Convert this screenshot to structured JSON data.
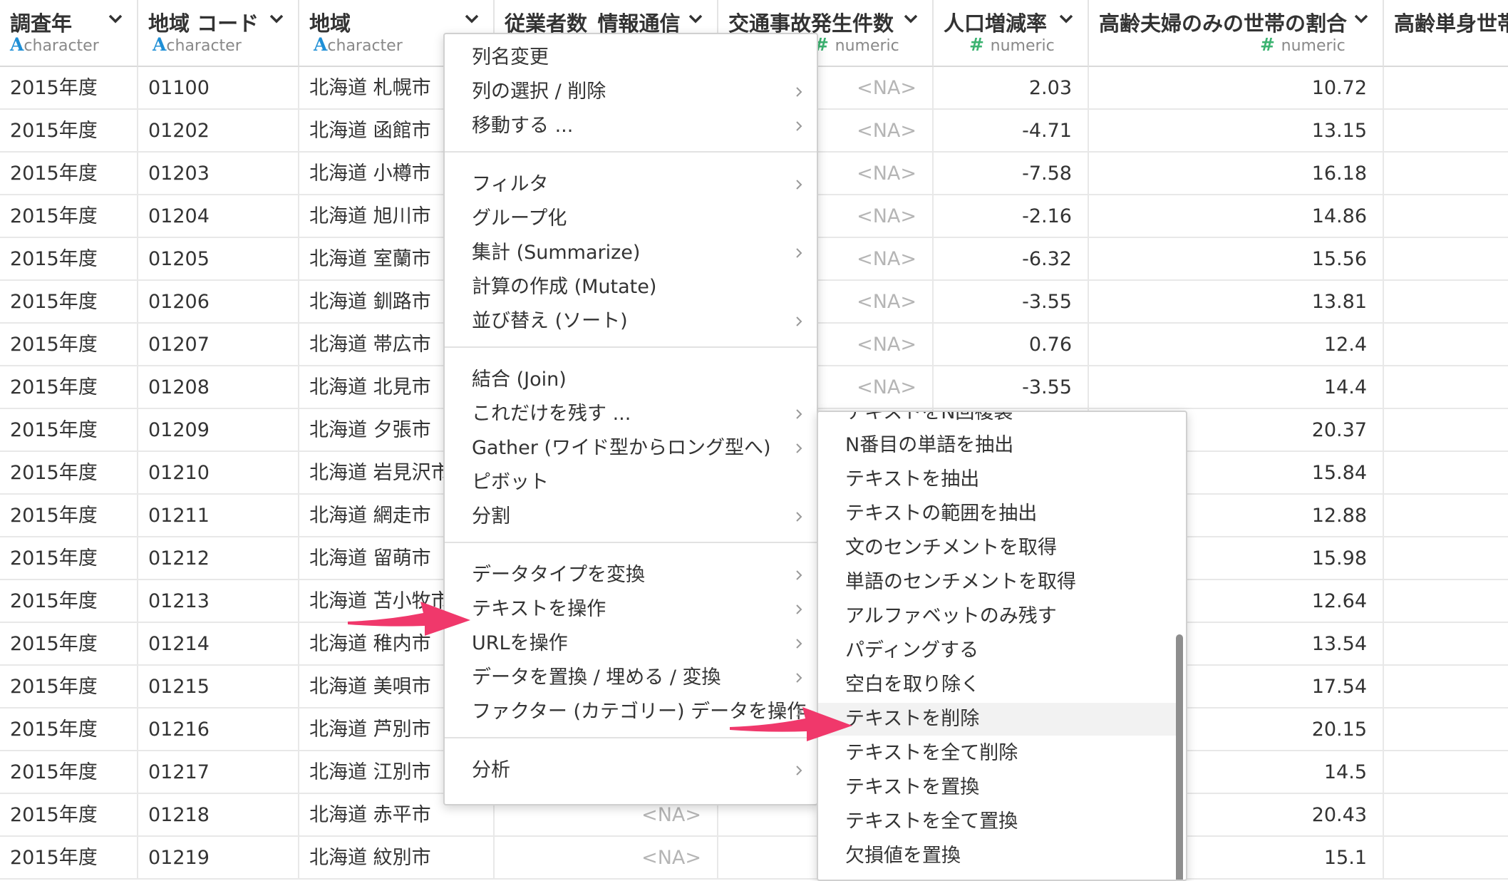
{
  "columns": [
    {
      "name": "調査年",
      "type": "character"
    },
    {
      "name": "地域 コード",
      "type": "character"
    },
    {
      "name": "地域",
      "type": "character"
    },
    {
      "name": "従業者数_情報通信",
      "type": ""
    },
    {
      "name": "交通事故発生件数",
      "type": "numeric"
    },
    {
      "name": "人口増減率",
      "type": "numeric"
    },
    {
      "name": "高齢夫婦のみの世帯の割合",
      "type": "numeric"
    },
    {
      "name": "高齢単身世帯",
      "type": ""
    }
  ],
  "rows": [
    [
      "2015年度",
      "01100",
      "北海道 札幌市",
      "",
      "<NA>",
      "2.03",
      "10.72"
    ],
    [
      "2015年度",
      "01202",
      "北海道 函館市",
      "",
      "<NA>",
      "-4.71",
      "13.15"
    ],
    [
      "2015年度",
      "01203",
      "北海道 小樽市",
      "",
      "<NA>",
      "-7.58",
      "16.18"
    ],
    [
      "2015年度",
      "01204",
      "北海道 旭川市",
      "",
      "<NA>",
      "-2.16",
      "14.86"
    ],
    [
      "2015年度",
      "01205",
      "北海道 室蘭市",
      "",
      "<NA>",
      "-6.32",
      "15.56"
    ],
    [
      "2015年度",
      "01206",
      "北海道 釧路市",
      "",
      "<NA>",
      "-3.55",
      "13.81"
    ],
    [
      "2015年度",
      "01207",
      "北海道 帯広市",
      "",
      "<NA>",
      "0.76",
      "12.4"
    ],
    [
      "2015年度",
      "01208",
      "北海道 北見市",
      "",
      "<NA>",
      "-3.55",
      "14.4"
    ],
    [
      "2015年度",
      "01209",
      "北海道 夕張市",
      "",
      "",
      "",
      "20.37"
    ],
    [
      "2015年度",
      "01210",
      "北海道 岩見沢市",
      "",
      "",
      "",
      "15.84"
    ],
    [
      "2015年度",
      "01211",
      "北海道 網走市",
      "",
      "",
      "",
      "12.88"
    ],
    [
      "2015年度",
      "01212",
      "北海道 留萌市",
      "",
      "",
      "",
      "15.98"
    ],
    [
      "2015年度",
      "01213",
      "北海道 苫小牧市",
      "",
      "",
      "",
      "12.64"
    ],
    [
      "2015年度",
      "01214",
      "北海道 稚内市",
      "",
      "",
      "",
      "13.54"
    ],
    [
      "2015年度",
      "01215",
      "北海道 美唄市",
      "",
      "",
      "",
      "17.54"
    ],
    [
      "2015年度",
      "01216",
      "北海道 芦別市",
      "",
      "",
      "",
      "20.15"
    ],
    [
      "2015年度",
      "01217",
      "北海道 江別市",
      "",
      "",
      "",
      "14.5"
    ],
    [
      "2015年度",
      "01218",
      "北海道 赤平市",
      "<NA>",
      "",
      "",
      "20.43"
    ],
    [
      "2015年度",
      "01219",
      "北海道 紋別市",
      "<NA>",
      "",
      "",
      "15.1"
    ]
  ],
  "context_menu": {
    "groups": [
      [
        {
          "label": "列名変更",
          "submenu": false
        },
        {
          "label": "列の選択 / 削除",
          "submenu": true
        },
        {
          "label": "移動する ...",
          "submenu": true
        }
      ],
      [
        {
          "label": "フィルタ",
          "submenu": true
        },
        {
          "label": "グループ化",
          "submenu": false
        },
        {
          "label": "集計 (Summarize)",
          "submenu": true
        },
        {
          "label": "計算の作成 (Mutate)",
          "submenu": false
        },
        {
          "label": "並び替え (ソート)",
          "submenu": true
        }
      ],
      [
        {
          "label": "結合 (Join)",
          "submenu": false
        },
        {
          "label": "これだけを残す ...",
          "submenu": true
        },
        {
          "label": "Gather (ワイド型からロング型へ)",
          "submenu": true
        },
        {
          "label": "ピボット",
          "submenu": false
        },
        {
          "label": "分割",
          "submenu": true
        }
      ],
      [
        {
          "label": "データタイプを変換",
          "submenu": true
        },
        {
          "label": "テキストを操作",
          "submenu": true
        },
        {
          "label": "URLを操作",
          "submenu": true
        },
        {
          "label": "データを置換 / 埋める / 変換",
          "submenu": true
        },
        {
          "label": "ファクター (カテゴリー) データを操作",
          "submenu": true
        }
      ],
      [
        {
          "label": "分析",
          "submenu": true
        }
      ]
    ]
  },
  "submenu": {
    "partial_top_label": "テキストをN回複製",
    "items": [
      "N番目の単語を抽出",
      "テキストを抽出",
      "テキストの範囲を抽出",
      "文のセンチメントを取得",
      "単語のセンチメントを取得",
      "アルファベットのみ残す",
      "パディングする",
      "空白を取り除く",
      "テキストを削除",
      "テキストを全て削除",
      "テキストを置換",
      "テキストを全て置換",
      "欠損値を置換"
    ],
    "highlighted_item": "テキストを削除"
  },
  "colors": {
    "arrow": "#f0386b",
    "character_icon": "#1f8fd6",
    "numeric_icon": "#3cb371"
  },
  "icons": [
    "chevron-down-icon",
    "chevron-right-icon",
    "annotation-arrow-icon"
  ]
}
